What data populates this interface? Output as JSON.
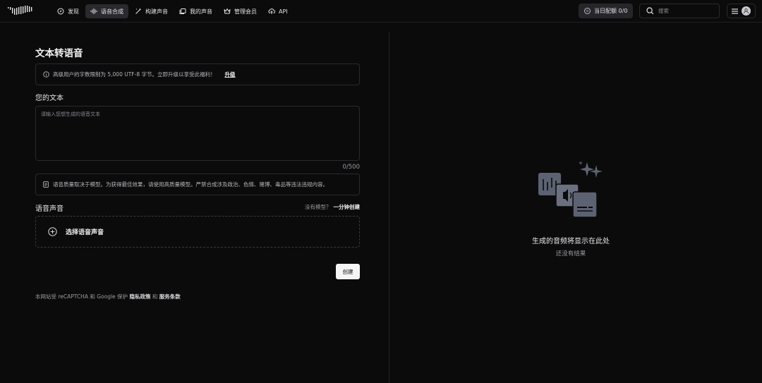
{
  "nav": {
    "items": [
      {
        "label": "发现",
        "icon": "compass-icon",
        "active": false
      },
      {
        "label": "语音合成",
        "icon": "soundwave-icon",
        "active": true
      },
      {
        "label": "构建声音",
        "icon": "magic-wand-icon",
        "active": false
      },
      {
        "label": "我的声音",
        "icon": "library-icon",
        "active": false
      },
      {
        "label": "管理会员",
        "icon": "crown-icon",
        "active": false
      },
      {
        "label": "API",
        "icon": "cloud-upload-icon",
        "active": false
      }
    ],
    "quota_label": "当日配额 0/0",
    "search_placeholder": "搜索"
  },
  "main": {
    "title": "文本转语音",
    "notice_text": "高级用户的字数限制为 5,000 UTF-8 字节。立即升级以享受此福利！",
    "notice_link": "升级",
    "text_label": "您的文本",
    "text_placeholder": "请输入您想生成的语音文本",
    "text_value": "",
    "char_counter": "0/500",
    "quality_note": "语音质量取决于模型。为获得最佳效果，请使用高质量模型。严禁合成涉及政治、色情、赌博、毒品等违法违规内容。",
    "voice_label": "语音声音",
    "no_model_text": "没有模型？",
    "one_minute_link": "一分钟创建",
    "select_voice_label": "选择语音声音",
    "create_button": "创建",
    "footer": {
      "prefix": "本网站受 reCAPTCHA 和 Google 保护",
      "privacy": "隐私政策",
      "and": "和",
      "terms": "服务条款"
    }
  },
  "result": {
    "empty_title": "生成的音频将显示在此处",
    "empty_subtitle": "还没有结果"
  },
  "colors": {
    "background": "#0b0b0c",
    "border": "#2a2a2e",
    "active_nav": "#2a2a2e",
    "illustration": "#5d6272",
    "button_bg": "#f5f5f6"
  }
}
